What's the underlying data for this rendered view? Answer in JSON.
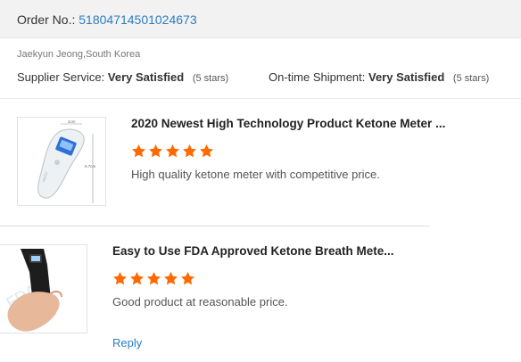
{
  "order": {
    "label": "Order No.:",
    "number": "51804714501024673"
  },
  "buyer": {
    "name_location": "Jaekyun Jeong,South Korea"
  },
  "ratings": {
    "supplier": {
      "label": "Supplier Service:",
      "value": "Very Satisfied",
      "note": "(5 stars)"
    },
    "shipment": {
      "label": "On-time Shipment:",
      "value": "Very Satisfied",
      "note": "(5 stars)"
    }
  },
  "products": [
    {
      "title": "2020 Newest High Technology Product Ketone Meter ...",
      "rating": 5,
      "comment": "High quality ketone meter with competitive price.",
      "image_labels": {
        "width": "2cm",
        "height": "8.7cm"
      }
    },
    {
      "title": "Easy to Use FDA Approved Ketone Breath Mete...",
      "rating": 5,
      "comment": "Good product at reasonable price."
    }
  ],
  "reply": {
    "label": "Reply"
  },
  "colors": {
    "link": "#2b7ec2",
    "star": "#ff6a00",
    "order_bar": "#f2f2f2"
  },
  "icons": {
    "star": "star-icon"
  }
}
